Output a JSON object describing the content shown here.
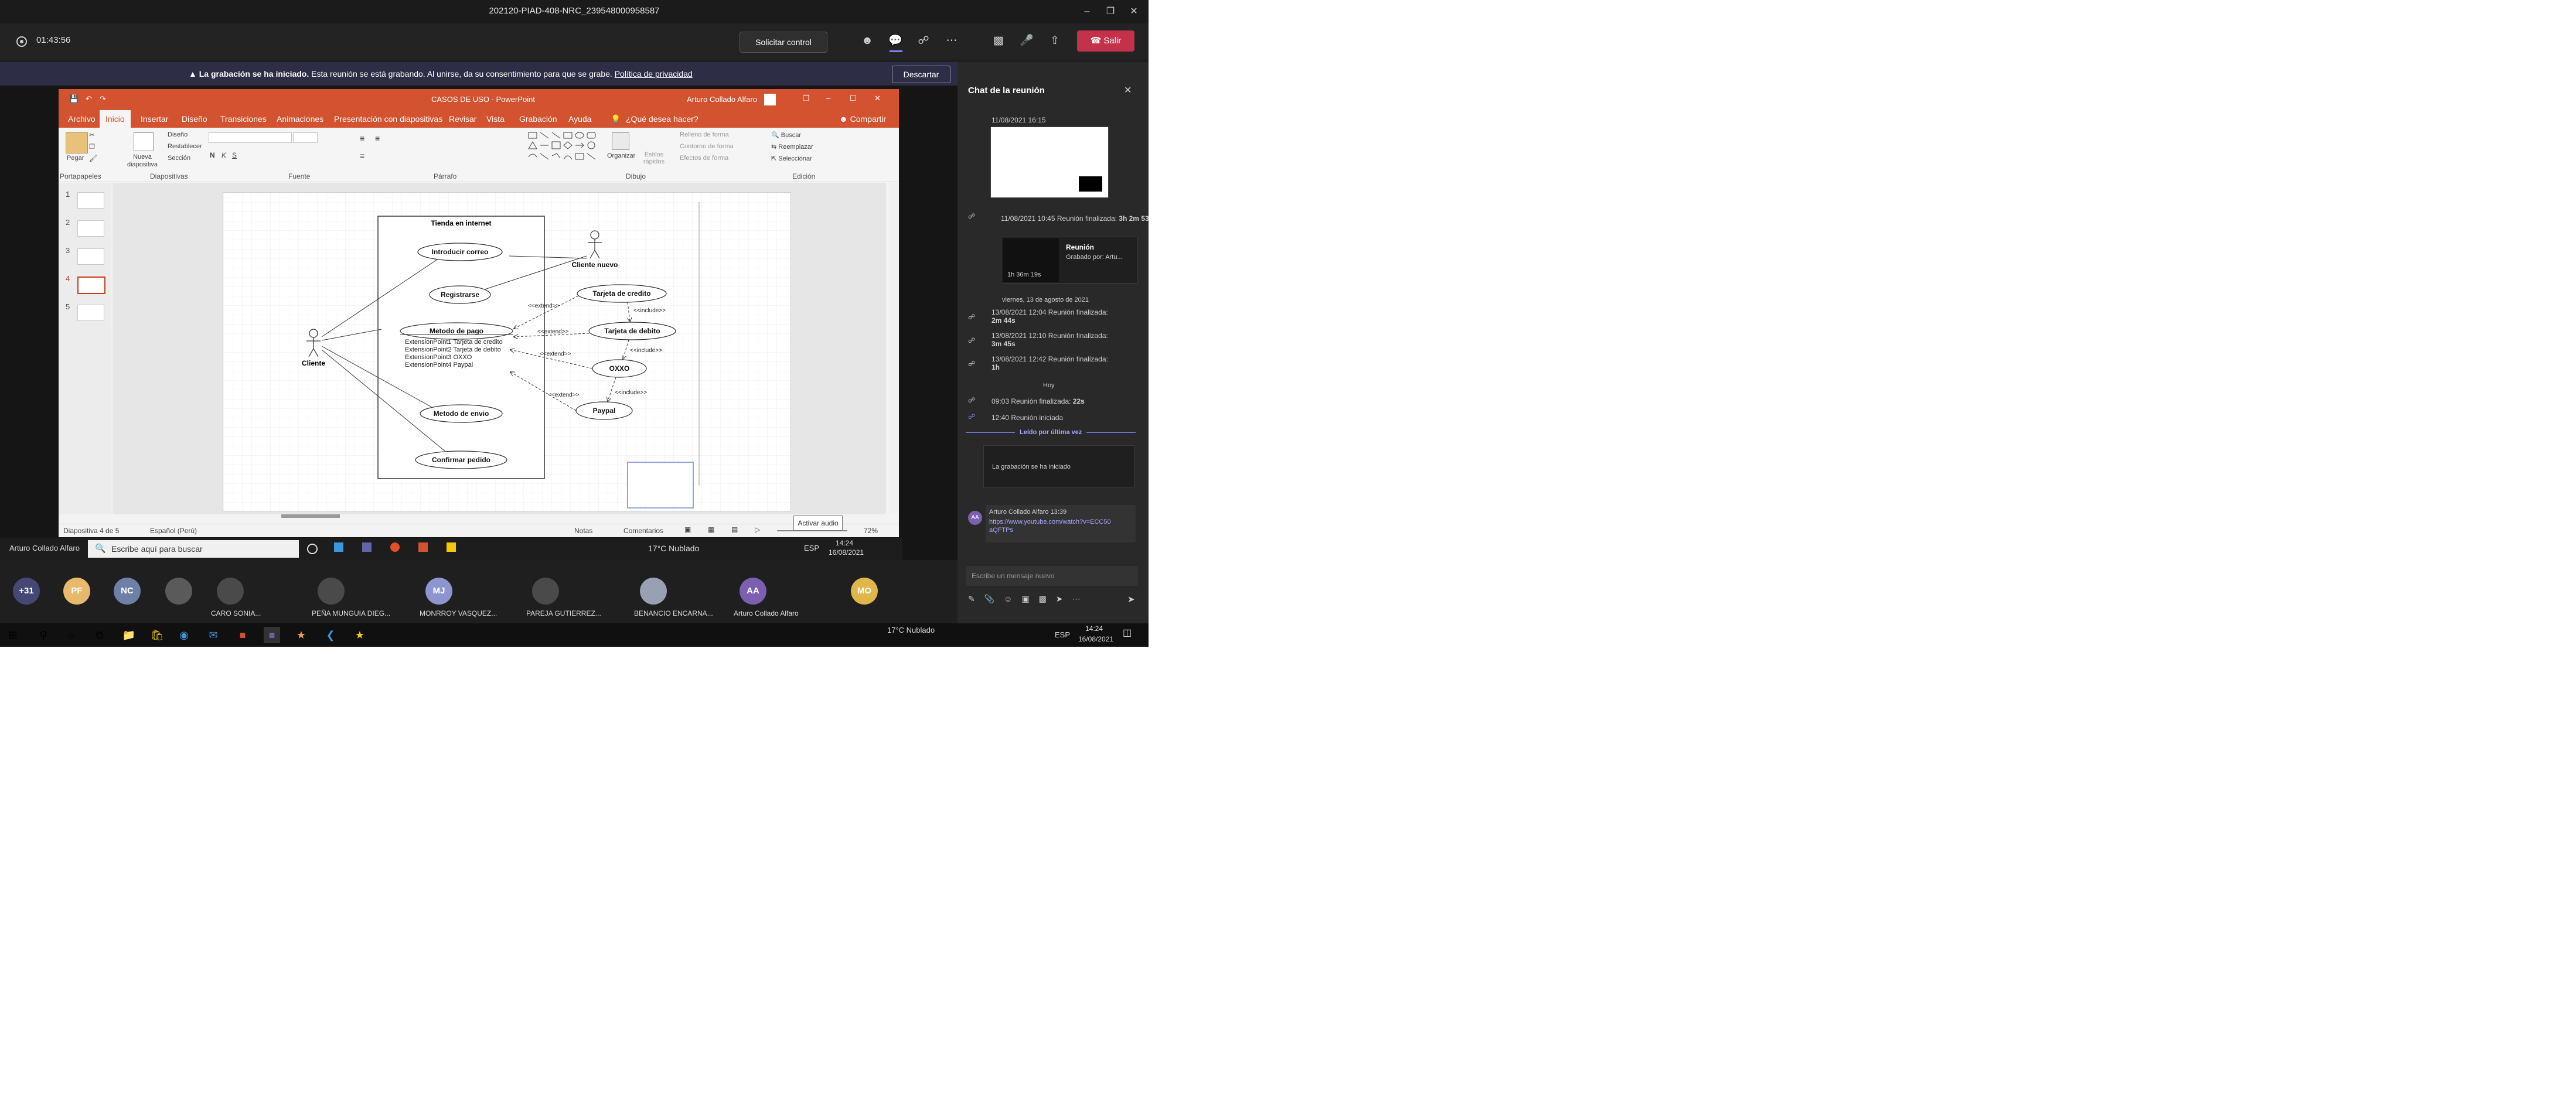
{
  "window": {
    "title": "202120-PIAD-408-NRC_239548000958587"
  },
  "meeting": {
    "timer": "01:43:56",
    "request_control": "Solicitar control",
    "leave": "Salir"
  },
  "banner": {
    "title": "La grabación se ha iniciado.",
    "message": "Esta reunión se está grabando. Al unirse, da su consentimiento para que se grabe.",
    "privacy": "Política de privacidad",
    "dismiss": "Descartar"
  },
  "ppt": {
    "doc_title": "CASOS DE USO  -  PowerPoint",
    "user": "Arturo Collado Alfaro",
    "menu": [
      "Archivo",
      "Inicio",
      "Insertar",
      "Diseño",
      "Transiciones",
      "Animaciones",
      "Presentación con diapositivas",
      "Revisar",
      "Vista",
      "Grabación",
      "Ayuda"
    ],
    "tell_me": "¿Qué desea hacer?",
    "share": "Compartir",
    "ribbon": {
      "paste": "Pegar",
      "new_slide": "Nueva diapositiva",
      "design": "Diseño",
      "reset": "Restablecer",
      "section": "Sección",
      "arrange": "Organizar",
      "quick_styles": "Estilos rápidos",
      "fill": "Relleno de forma",
      "outline": "Contorno de forma",
      "effects": "Efectos de forma",
      "find": "Buscar",
      "replace": "Reemplazar",
      "select": "Seleccionar"
    },
    "groups": {
      "clipboard": "Portapapeles",
      "slides": "Diapositivas",
      "font": "Fuente",
      "paragraph": "Párrafo",
      "drawing": "Dibujo",
      "editing": "Edición"
    },
    "thumb_numbers": [
      "1",
      "2",
      "3",
      "4",
      "5"
    ],
    "status": {
      "slide": "Diapositiva 4 de 5",
      "language": "Español (Perú)",
      "notes": "Notas",
      "comments": "Comentarios",
      "zoom": "72%"
    },
    "tooltip": "Activar audio"
  },
  "diagram": {
    "system": "Tienda en internet",
    "actors": {
      "client": "Cliente",
      "new_client": "Cliente nuevo"
    },
    "usecases": {
      "intro": "Introducir correo",
      "register": "Registrarse",
      "payment": "Metodo de pago",
      "shipping": "Metodo de envio",
      "confirm": "Confirmar pedido",
      "credit": "Tarjeta de credito",
      "debit": "Tarjeta de debito",
      "oxxo": "OXXO",
      "paypal": "Paypal"
    },
    "ext_points": [
      "ExtensionPoint1 Tarjeta de credito",
      "ExtensionPoint2 Tarjeta de debito",
      "ExtensionPoint3 OXXO",
      "ExtensionPoint4 Paypal"
    ],
    "extend": "<<extend>>",
    "include": "<<include>>"
  },
  "remote_taskbar": {
    "search": "Escribe aquí para buscar",
    "weather": "17°C  Nublado",
    "lang": "ESP",
    "time": "14:24",
    "date": "16/08/2021",
    "presenter": "Arturo Collado Alfaro"
  },
  "participants": [
    {
      "initials": "+31",
      "color": "#464775",
      "name": ""
    },
    {
      "initials": "PF",
      "color": "#e8b86d",
      "name": ""
    },
    {
      "initials": "NC",
      "color": "#6e7fa8",
      "name": ""
    },
    {
      "initials": "",
      "color": "#5a5a5a",
      "name": ""
    },
    {
      "initials": "",
      "color": "#4a4a4a",
      "name": "CARO SONIA..."
    },
    {
      "initials": "",
      "color": "#4a4a4a",
      "name": "PEÑA MUNGUIA DIEG..."
    },
    {
      "initials": "MJ",
      "color": "#8c95cf",
      "name": "MONRROY VASQUEZ..."
    },
    {
      "initials": "",
      "color": "#4a4a4a",
      "name": "PAREJA GUTIERREZ..."
    },
    {
      "initials": "",
      "color": "#9aa0b3",
      "name": "BENANCIO ENCARNA..."
    },
    {
      "initials": "AA",
      "color": "#7b5fb0",
      "name": "Arturo Collado Alfaro"
    },
    {
      "initials": "MO",
      "color": "#e0b64a",
      "name": ""
    }
  ],
  "chat": {
    "title": "Chat de la reunión",
    "top_time": "11/08/2021 16:15",
    "entries": [
      {
        "time": "11/08/2021 10:45",
        "text": "Reunión finalizada:",
        "bold": "3h 2m 53s"
      },
      {
        "time": "",
        "text": "Reunión",
        "bold": "Grabado por: Artu..."
      },
      {
        "time": "",
        "text": "",
        "bold": "1h 36m 19s"
      }
    ],
    "date_sep": "viernes, 13 de agosto de 2021",
    "events": [
      {
        "time": "13/08/2021 12:04",
        "text": "Reunión finalizada:",
        "bold": "2m 44s"
      },
      {
        "time": "13/08/2021 12:10",
        "text": "Reunión finalizada:",
        "bold": "3m 45s"
      },
      {
        "time": "13/08/2021 12:42",
        "text": "Reunión finalizada:",
        "bold": "1h"
      }
    ],
    "today": "Hoy",
    "today_events": [
      {
        "time": "09:03",
        "text": "Reunión finalizada:",
        "bold": "22s"
      },
      {
        "time": "12:40",
        "text": "Reunión iniciada"
      }
    ],
    "last_read": "Leído por última vez",
    "recording_started": "La grabación se ha iniciado",
    "author": "Arturo Collado Alfaro",
    "author_time": "13:39",
    "link": "https://www.youtube.com/watch?v=ECC50aQFTPs",
    "author_initials": "AA",
    "input_placeholder": "Escribe un mensaje nuevo"
  },
  "win_taskbar": {
    "weather": "17°C  Nublado",
    "lang": "ESP",
    "time": "14:24",
    "date": "16/08/2021"
  },
  "colors": {
    "ppt": "#d35230",
    "leave": "#c4314b",
    "banner": "#2d2d45",
    "teams": "#6264a7"
  }
}
